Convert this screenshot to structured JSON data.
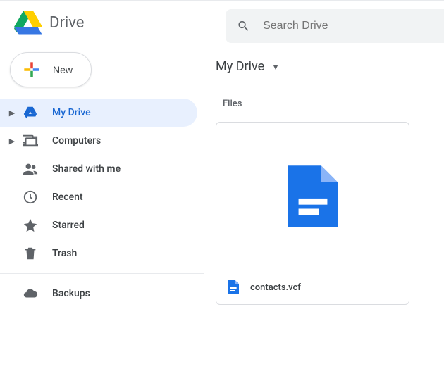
{
  "header": {
    "app_name": "Drive",
    "search_placeholder": "Search Drive"
  },
  "sidebar": {
    "new_label": "New",
    "items": [
      {
        "label": "My Drive",
        "icon": "drive-icon",
        "expandable": true,
        "active": true
      },
      {
        "label": "Computers",
        "icon": "computers-icon",
        "expandable": true,
        "active": false
      },
      {
        "label": "Shared with me",
        "icon": "shared-icon",
        "expandable": false,
        "active": false
      },
      {
        "label": "Recent",
        "icon": "recent-icon",
        "expandable": false,
        "active": false
      },
      {
        "label": "Starred",
        "icon": "starred-icon",
        "expandable": false,
        "active": false
      },
      {
        "label": "Trash",
        "icon": "trash-icon",
        "expandable": false,
        "active": false
      }
    ],
    "secondary": [
      {
        "label": "Backups",
        "icon": "backups-icon"
      }
    ]
  },
  "main": {
    "breadcrumb": "My Drive",
    "section_label": "Files",
    "files": [
      {
        "name": "contacts.vcf",
        "type": "document"
      }
    ]
  },
  "colors": {
    "active_bg": "#e8f0fe",
    "active_text": "#1967d2",
    "doc_blue": "#1a73e8"
  }
}
